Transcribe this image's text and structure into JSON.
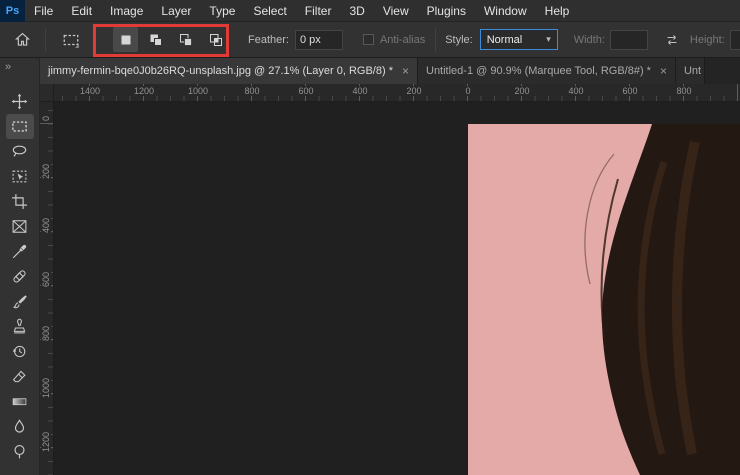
{
  "window": {
    "logo": "Ps"
  },
  "menu": {
    "items": [
      "File",
      "Edit",
      "Image",
      "Layer",
      "Type",
      "Select",
      "Filter",
      "3D",
      "View",
      "Plugins",
      "Window",
      "Help"
    ]
  },
  "options": {
    "selection_modes": [
      "New selection",
      "Add to selection",
      "Subtract from selection",
      "Intersect with selection"
    ],
    "feather_label": "Feather:",
    "feather_value": "0 px",
    "antialias_label": "Anti-alias",
    "style_label": "Style:",
    "style_value": "Normal",
    "style_chevron": "▾",
    "width_label": "Width:",
    "width_value": "",
    "height_label": "Height:",
    "height_value": ""
  },
  "tabs": [
    {
      "label": "jimmy-fermin-bqe0J0b26RQ-unsplash.jpg @ 27.1% (Layer 0, RGB/8) *",
      "close": "×"
    },
    {
      "label": "Untitled-1 @ 90.9% (Marquee Tool, RGB/8#) *",
      "close": "×"
    },
    {
      "label": "Unt"
    }
  ],
  "toolbar": {
    "expand_glyph": "»",
    "tools": [
      "Move Tool",
      "Rectangular Marquee Tool",
      "Lasso Tool",
      "Object Selection Tool",
      "Crop Tool",
      "Frame Tool",
      "Eyedropper Tool",
      "Spot Healing Brush Tool",
      "Brush Tool",
      "Clone Stamp Tool",
      "History Brush Tool",
      "Eraser Tool",
      "Gradient Tool",
      "Blur Tool",
      "Dodge Tool"
    ]
  },
  "rulers": {
    "horizontal": [
      "1400",
      "1200",
      "1000",
      "800",
      "600",
      "400",
      "200",
      "0",
      "200",
      "400",
      "600",
      "800"
    ],
    "vertical": [
      "0",
      "200",
      "400",
      "600",
      "800",
      "1000",
      "1200"
    ]
  },
  "colors": {
    "annotation_red": "#e23a36",
    "accent_blue": "#3e8ddd",
    "photo_pink": "#e4aaa7",
    "hair_dark": "#241812",
    "ui_dark": "#323232"
  }
}
